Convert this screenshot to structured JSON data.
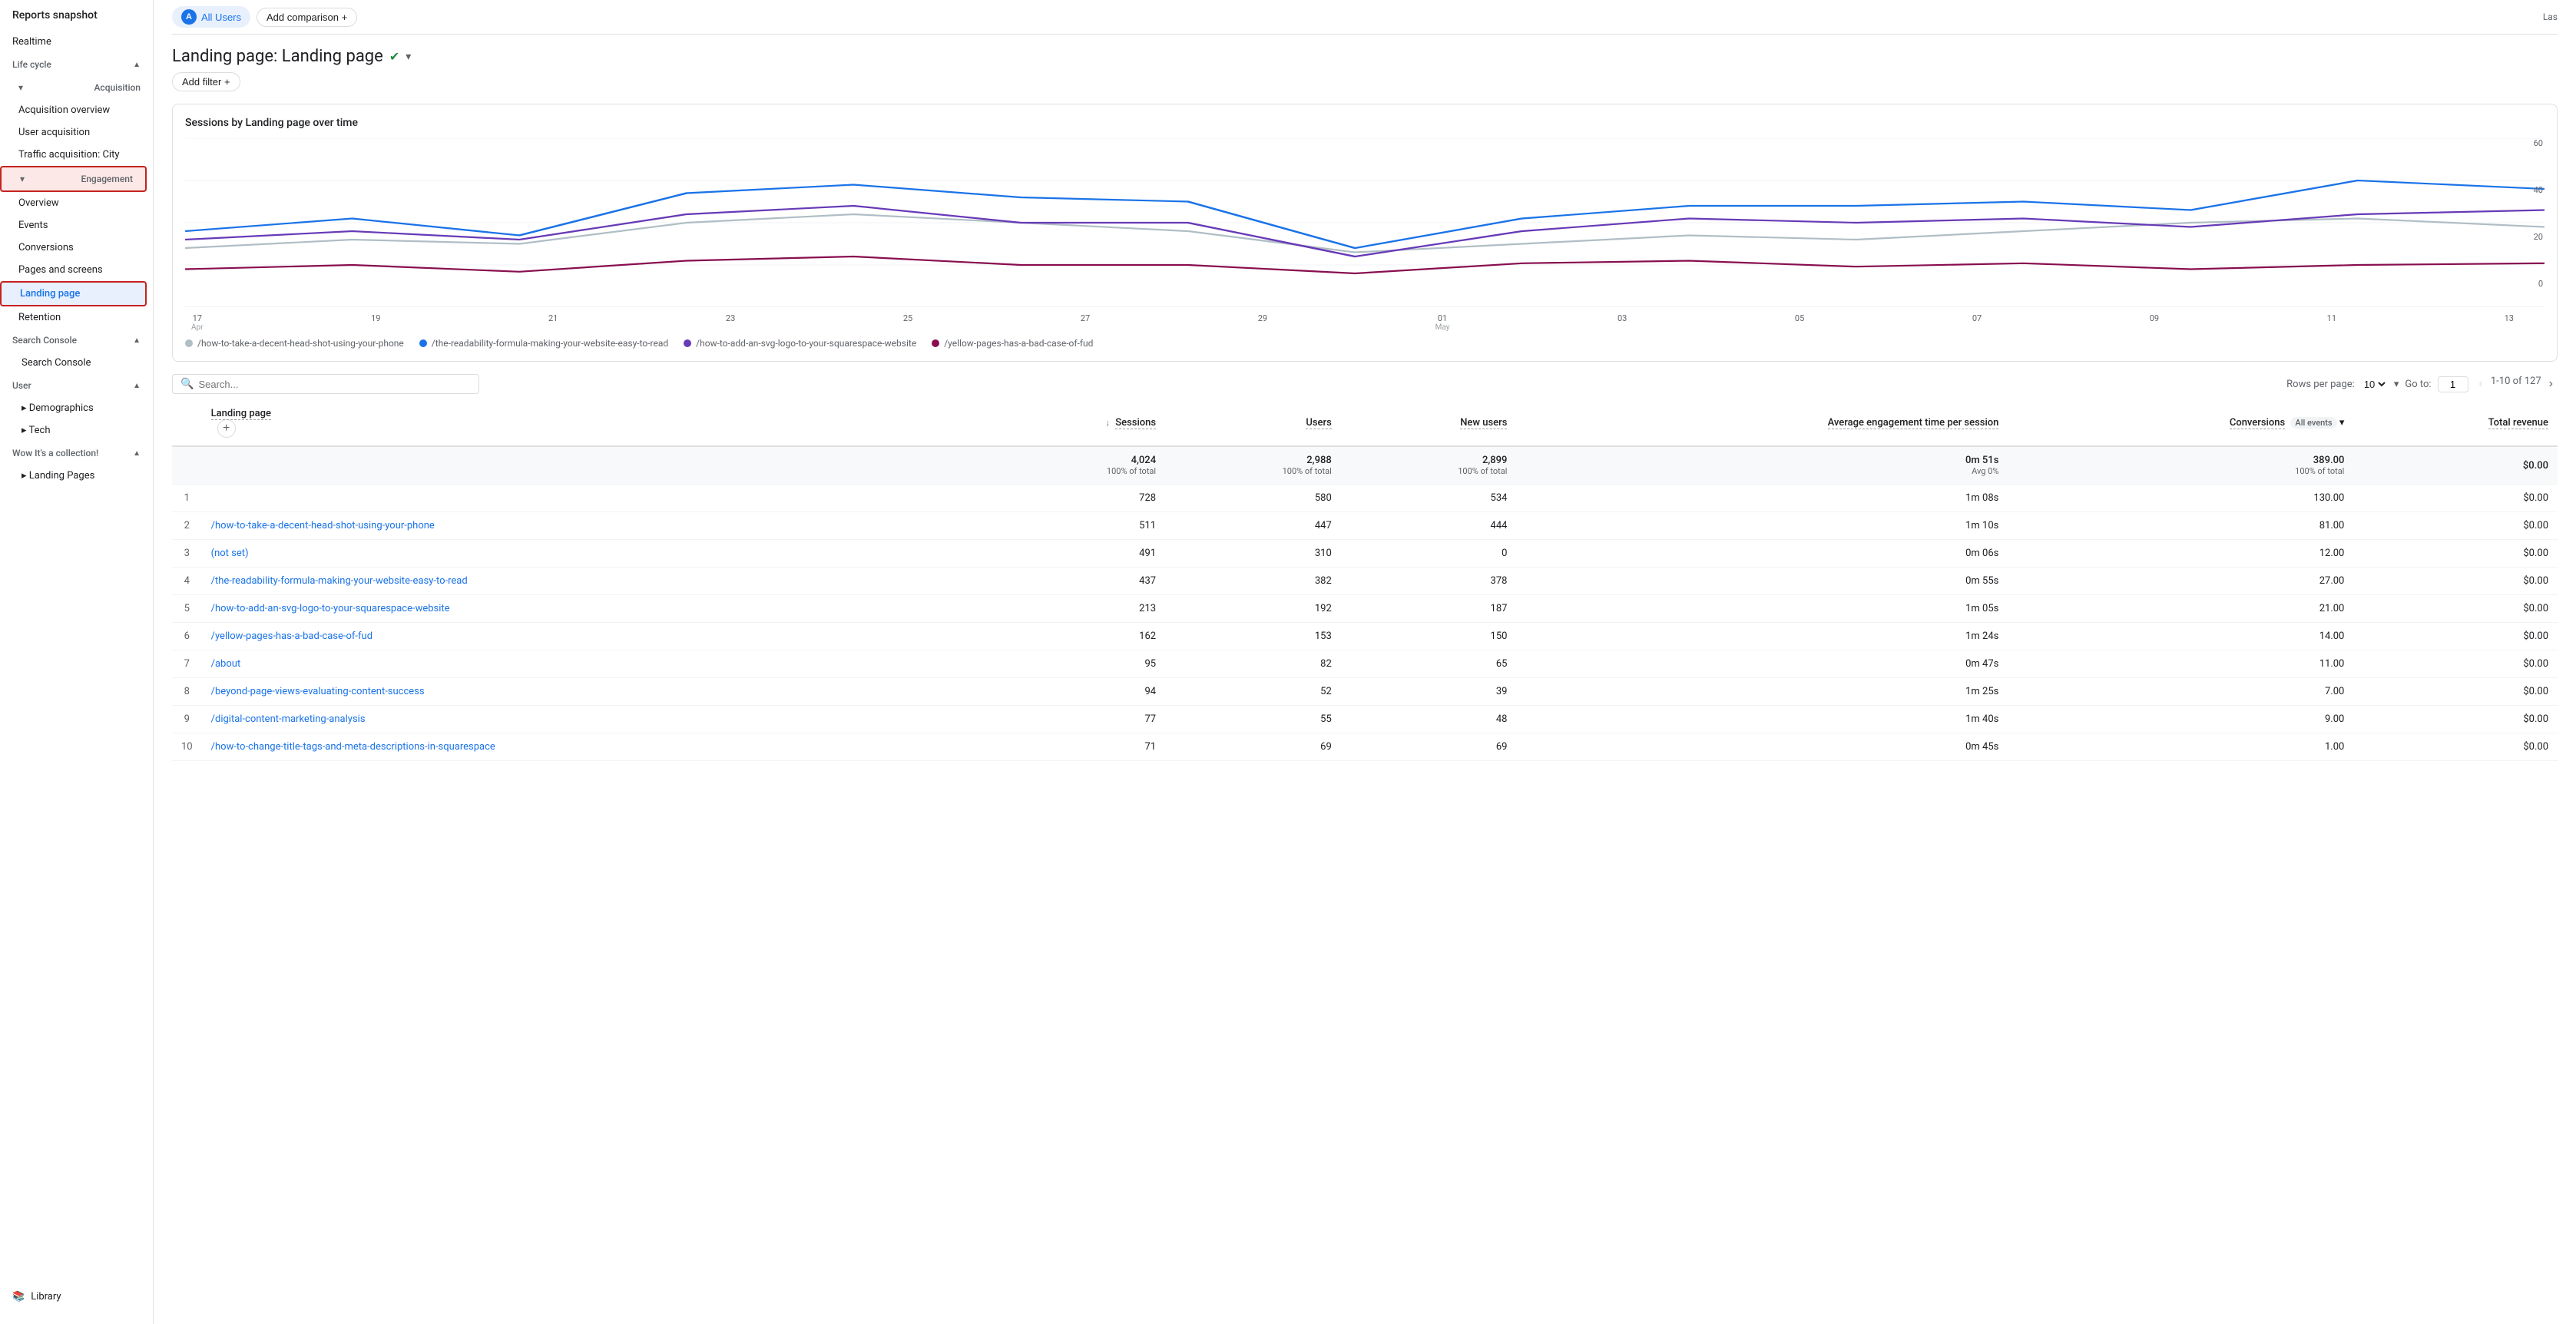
{
  "sidebar": {
    "header": "Reports snapshot",
    "realtime": "Realtime",
    "lifecycle": "Life cycle",
    "acquisition": {
      "label": "Acquisition",
      "items": [
        "Acquisition overview",
        "User acquisition",
        "Traffic acquisition: City"
      ]
    },
    "engagement": {
      "label": "Engagement",
      "items": [
        "Overview",
        "Events",
        "Conversions",
        "Pages and screens",
        "Landing page",
        "Retention"
      ]
    },
    "searchConsole1": "Search Console",
    "searchConsole2": "Search Console",
    "user": "User",
    "demographics": "Demographics",
    "tech": "Tech",
    "collection": "Wow It's a collection!",
    "landingPages": "Landing Pages",
    "library": "Library"
  },
  "topbar": {
    "allUsers": "All Users",
    "addComparison": "Add comparison",
    "last": "Las"
  },
  "page": {
    "title": "Landing page: Landing page",
    "addFilter": "Add filter"
  },
  "chart": {
    "title": "Sessions by Landing page over time",
    "yLabels": [
      "60",
      "40",
      "20",
      "0"
    ],
    "xLabels": [
      {
        "date": "17",
        "month": "Apr"
      },
      {
        "date": "19",
        "month": ""
      },
      {
        "date": "21",
        "month": ""
      },
      {
        "date": "23",
        "month": ""
      },
      {
        "date": "25",
        "month": ""
      },
      {
        "date": "27",
        "month": ""
      },
      {
        "date": "29",
        "month": ""
      },
      {
        "date": "01",
        "month": "May"
      },
      {
        "date": "03",
        "month": ""
      },
      {
        "date": "05",
        "month": ""
      },
      {
        "date": "07",
        "month": ""
      },
      {
        "date": "09",
        "month": ""
      },
      {
        "date": "11",
        "month": ""
      },
      {
        "date": "13",
        "month": ""
      }
    ],
    "legend": [
      {
        "color": "#b0bec5",
        "label": "/how-to-take-a-decent-head-shot-using-your-phone"
      },
      {
        "color": "#1a73e8",
        "label": "/the-readability-formula-making-your-website-easy-to-read"
      },
      {
        "color": "#673ab7",
        "label": "/how-to-add-an-svg-logo-to-your-squarespace-website"
      },
      {
        "color": "#880e4f",
        "label": "/yellow-pages-has-a-bad-case-of-fud"
      }
    ]
  },
  "table": {
    "searchPlaceholder": "Search...",
    "rowsPerPageLabel": "Rows per page:",
    "rowsPerPageValue": "10",
    "gotoLabel": "Go to:",
    "gotoValue": "1",
    "pageInfo": "1-10 of 127",
    "addColBtn": "+",
    "columns": {
      "landingPage": "Landing page",
      "sessions": "Sessions",
      "users": "Users",
      "newUsers": "New users",
      "avgEngagement": "Average engagement time per session",
      "conversions": "Conversions",
      "conversionsFilter": "All events",
      "totalRevenue": "Total revenue"
    },
    "totals": {
      "sessions": "4,024",
      "sessionsPct": "100% of total",
      "users": "2,988",
      "usersPct": "100% of total",
      "newUsers": "2,899",
      "newUsersPct": "100% of total",
      "avgEngagement": "0m 51s",
      "avgEngagementAvg": "Avg 0%",
      "conversions": "389.00",
      "conversionsPct": "100% of total",
      "totalRevenue": "$0.00"
    },
    "rows": [
      {
        "num": "1",
        "page": "",
        "sessions": "728",
        "users": "580",
        "newUsers": "534",
        "avgEng": "1m 08s",
        "conv": "130.00",
        "rev": "$0.00"
      },
      {
        "num": "2",
        "page": "/how-to-take-a-decent-head-shot-using-your-phone",
        "sessions": "511",
        "users": "447",
        "newUsers": "444",
        "avgEng": "1m 10s",
        "conv": "81.00",
        "rev": "$0.00"
      },
      {
        "num": "3",
        "page": "(not set)",
        "sessions": "491",
        "users": "310",
        "newUsers": "0",
        "avgEng": "0m 06s",
        "conv": "12.00",
        "rev": "$0.00"
      },
      {
        "num": "4",
        "page": "/the-readability-formula-making-your-website-easy-to-read",
        "sessions": "437",
        "users": "382",
        "newUsers": "378",
        "avgEng": "0m 55s",
        "conv": "27.00",
        "rev": "$0.00"
      },
      {
        "num": "5",
        "page": "/how-to-add-an-svg-logo-to-your-squarespace-website",
        "sessions": "213",
        "users": "192",
        "newUsers": "187",
        "avgEng": "1m 05s",
        "conv": "21.00",
        "rev": "$0.00"
      },
      {
        "num": "6",
        "page": "/yellow-pages-has-a-bad-case-of-fud",
        "sessions": "162",
        "users": "153",
        "newUsers": "150",
        "avgEng": "1m 24s",
        "conv": "14.00",
        "rev": "$0.00"
      },
      {
        "num": "7",
        "page": "/about",
        "sessions": "95",
        "users": "82",
        "newUsers": "65",
        "avgEng": "0m 47s",
        "conv": "11.00",
        "rev": "$0.00"
      },
      {
        "num": "8",
        "page": "/beyond-page-views-evaluating-content-success",
        "sessions": "94",
        "users": "52",
        "newUsers": "39",
        "avgEng": "1m 25s",
        "conv": "7.00",
        "rev": "$0.00"
      },
      {
        "num": "9",
        "page": "/digital-content-marketing-analysis",
        "sessions": "77",
        "users": "55",
        "newUsers": "48",
        "avgEng": "1m 40s",
        "conv": "9.00",
        "rev": "$0.00"
      },
      {
        "num": "10",
        "page": "/how-to-change-title-tags-and-meta-descriptions-in-squarespace",
        "sessions": "71",
        "users": "69",
        "newUsers": "69",
        "avgEng": "0m 45s",
        "conv": "1.00",
        "rev": "$0.00"
      }
    ]
  },
  "colors": {
    "accent": "#1a73e8",
    "activeNav": "#e8f0fe",
    "activeBorder": "#c5221f",
    "line1": "#b0bec5",
    "line2": "#1a73e8",
    "line3": "#673ab7",
    "line4": "#880e4f"
  }
}
